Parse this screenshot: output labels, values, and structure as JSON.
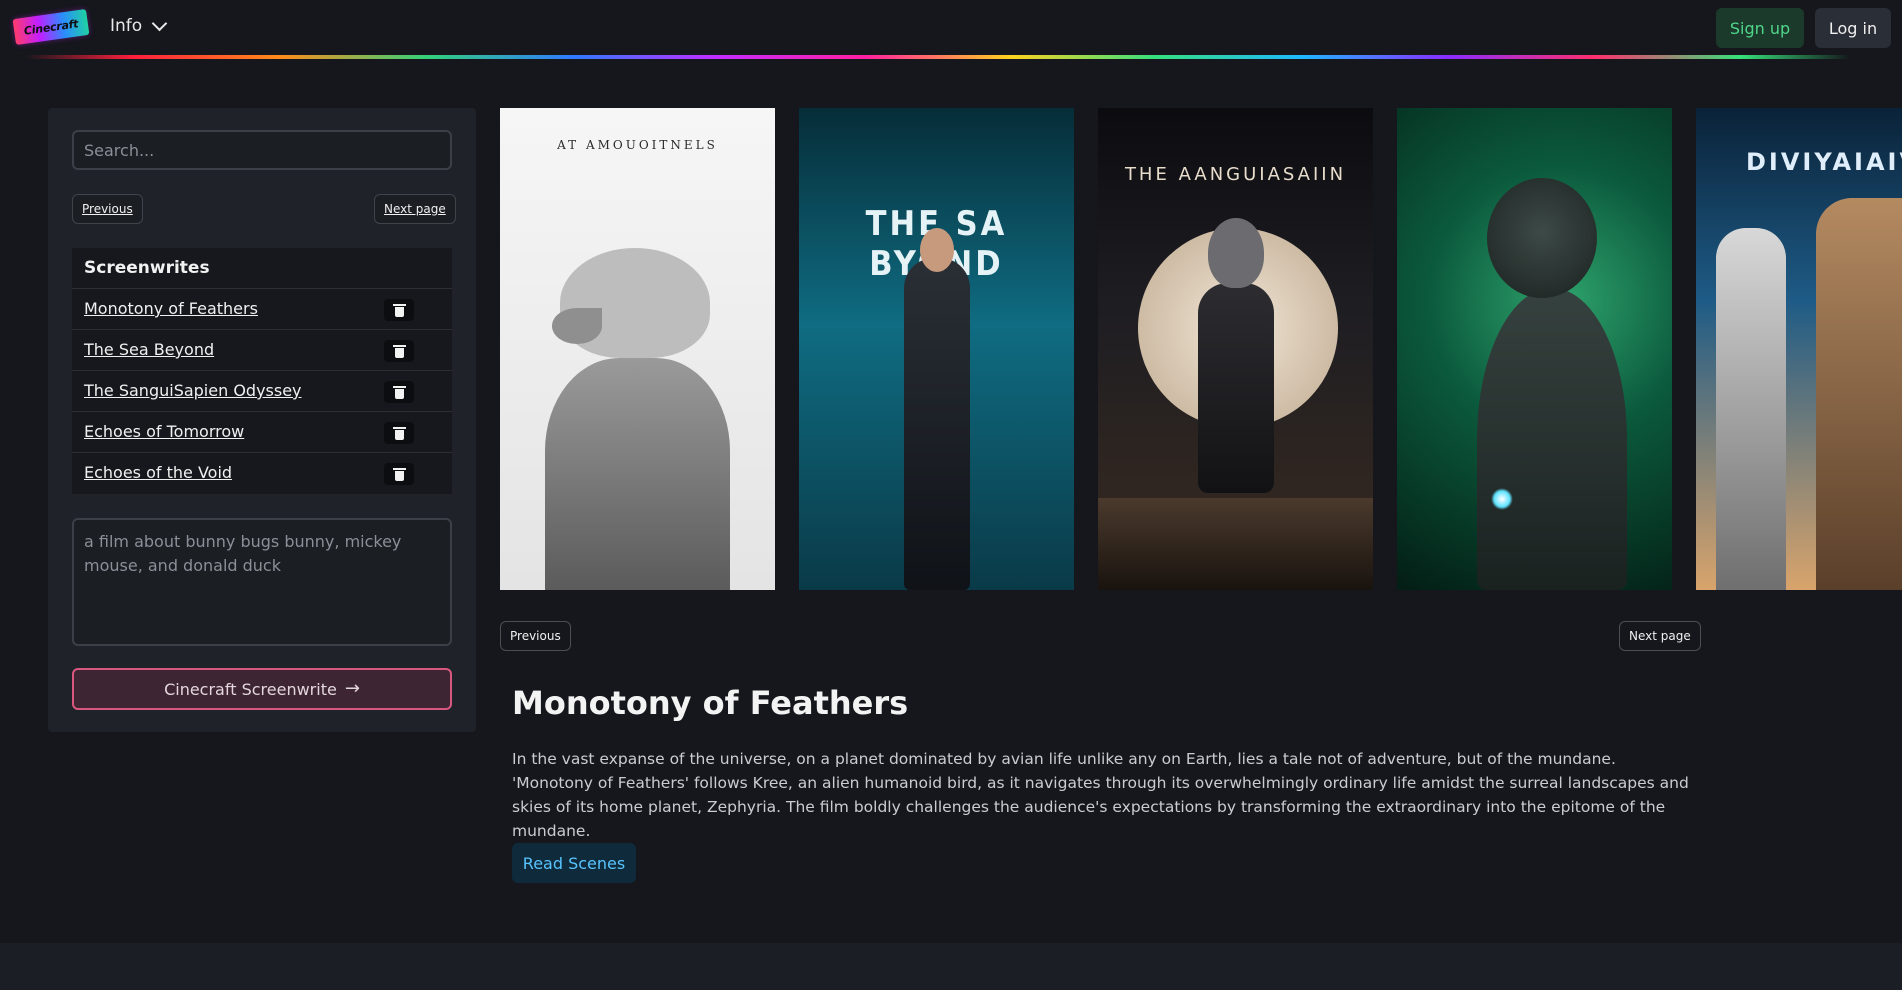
{
  "header": {
    "logo_text": "Cinecraft",
    "info_label": "Info",
    "signup_label": "Sign up",
    "login_label": "Log in"
  },
  "sidebar": {
    "search_placeholder": "Search...",
    "previous_label": "Previous",
    "next_label": "Next page",
    "list_title": "Screenwrites",
    "items": [
      {
        "label": "Monotony of Feathers"
      },
      {
        "label": "The Sea Beyond"
      },
      {
        "label": "The SanguiSapien Odyssey"
      },
      {
        "label": "Echoes of Tomorrow"
      },
      {
        "label": "Echoes of the Void"
      }
    ],
    "prompt_placeholder": "a film about bunny bugs bunny, mickey mouse, and donald duck",
    "submit_label": "Cinecraft Screenwrite",
    "submit_icon": "arrow-right-icon"
  },
  "posters": [
    {
      "title": "AT AMOUOITNELS"
    },
    {
      "title": "THE SA BYOND"
    },
    {
      "title": "THE AANGUIASAIIN"
    },
    {
      "title": ""
    },
    {
      "title": "DIVIYAIAIVFO"
    }
  ],
  "carousel": {
    "previous_label": "Previous",
    "next_label": "Next page"
  },
  "detail": {
    "title": "Monotony of Feathers",
    "description": "In the vast expanse of the universe, on a planet dominated by avian life unlike any on Earth, lies a tale not of adventure, but of the mundane. 'Monotony of Feathers' follows Kree, an alien humanoid bird, as it navigates through its overwhelmingly ordinary life amidst the surreal landscapes and skies of its home planet, Zephyria. The film boldly challenges the audience's expectations by transforming the extraordinary into the epitome of the mundane.",
    "read_label": "Read Scenes"
  },
  "colors": {
    "background": "#15171c",
    "panel": "#1f2329",
    "accent_pink": "#d9577f",
    "signup_green": "#4fd68a",
    "read_blue": "#58c4ff"
  }
}
